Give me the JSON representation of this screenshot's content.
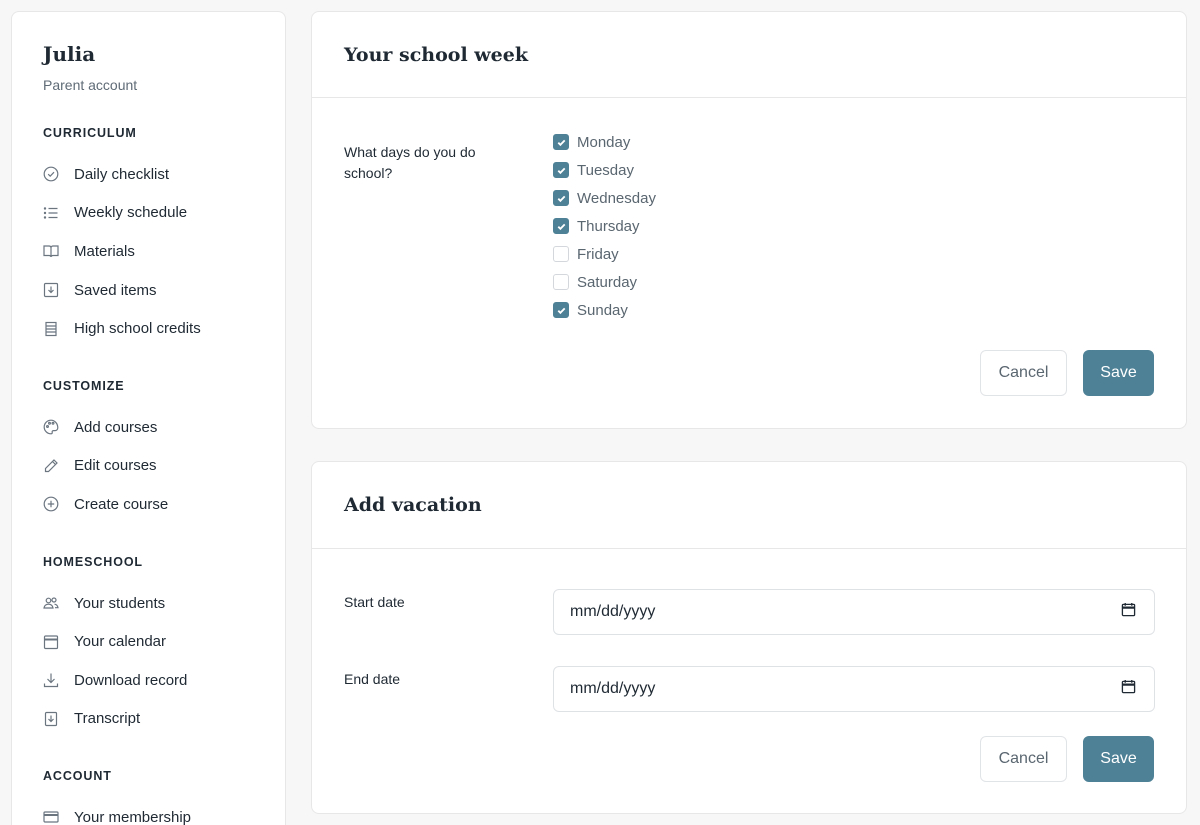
{
  "sidebar": {
    "user_name": "Julia",
    "user_sub": "Parent account",
    "sections": [
      {
        "title": "CURRICULUM",
        "items": [
          {
            "label": "Daily checklist",
            "icon": "check-circle-icon"
          },
          {
            "label": "Weekly schedule",
            "icon": "list-icon"
          },
          {
            "label": "Materials",
            "icon": "book-icon"
          },
          {
            "label": "Saved items",
            "icon": "save-icon"
          },
          {
            "label": "High school credits",
            "icon": "ledger-icon"
          }
        ]
      },
      {
        "title": "CUSTOMIZE",
        "items": [
          {
            "label": "Add courses",
            "icon": "palette-icon"
          },
          {
            "label": "Edit courses",
            "icon": "pencil-icon"
          },
          {
            "label": "Create course",
            "icon": "plus-circle-icon"
          }
        ]
      },
      {
        "title": "HOMESCHOOL",
        "items": [
          {
            "label": "Your students",
            "icon": "users-icon"
          },
          {
            "label": "Your calendar",
            "icon": "calendar-icon"
          },
          {
            "label": "Download record",
            "icon": "download-icon"
          },
          {
            "label": "Transcript",
            "icon": "document-download-icon"
          }
        ]
      },
      {
        "title": "ACCOUNT",
        "items": [
          {
            "label": "Your membership",
            "icon": "card-icon"
          }
        ]
      }
    ]
  },
  "school_week": {
    "title": "Your school week",
    "question": "What days do you do school?",
    "days": [
      {
        "label": "Monday",
        "checked": true
      },
      {
        "label": "Tuesday",
        "checked": true
      },
      {
        "label": "Wednesday",
        "checked": true
      },
      {
        "label": "Thursday",
        "checked": true
      },
      {
        "label": "Friday",
        "checked": false
      },
      {
        "label": "Saturday",
        "checked": false
      },
      {
        "label": "Sunday",
        "checked": true
      }
    ],
    "cancel_label": "Cancel",
    "save_label": "Save"
  },
  "vacation": {
    "title": "Add vacation",
    "start_label": "Start date",
    "start_value": "mm/dd/yyyy",
    "end_label": "End date",
    "end_value": "mm/dd/yyyy",
    "cancel_label": "Cancel",
    "save_label": "Save"
  },
  "colors": {
    "accent": "#4e8196",
    "text": "#1f2933",
    "muted": "#5f6b76",
    "border": "#e7e7e7",
    "background": "#f7f7f7"
  }
}
